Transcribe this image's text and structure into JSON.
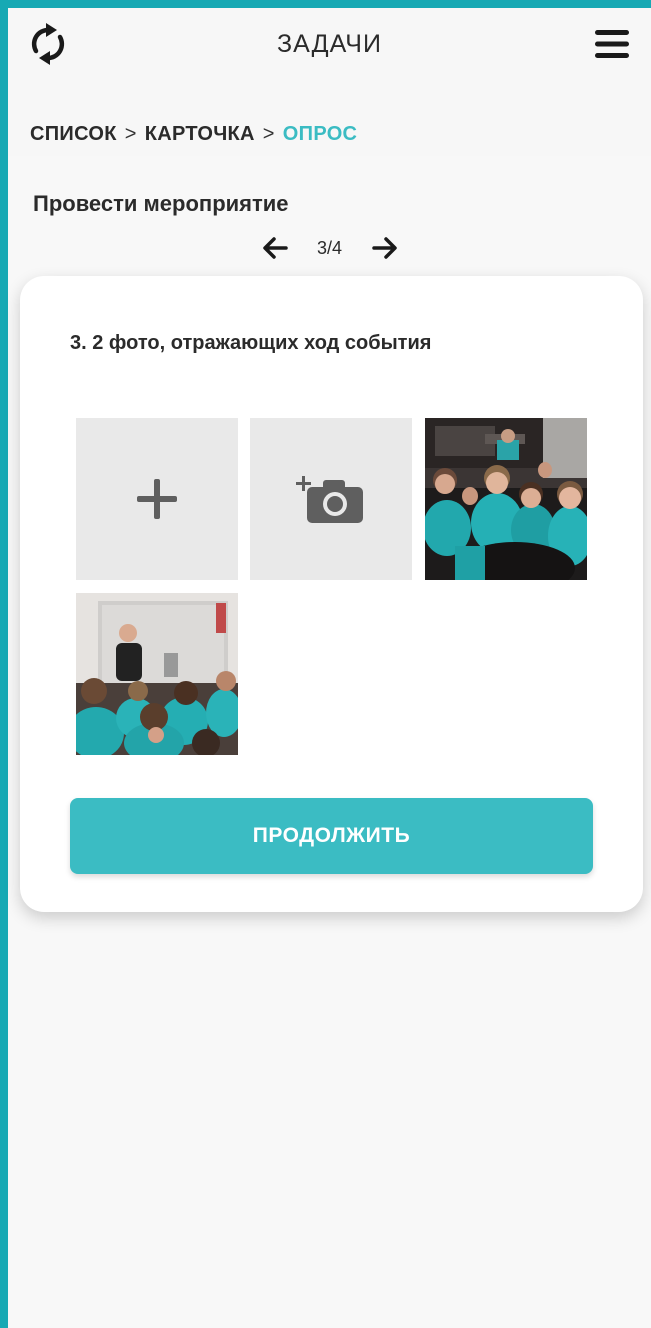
{
  "header": {
    "title": "ЗАДАЧИ",
    "refresh_icon": "refresh-icon",
    "menu_icon": "hamburger-menu-icon"
  },
  "breadcrumb": {
    "items": [
      "СПИСОК",
      "КАРТОЧКА",
      "ОПРОС"
    ],
    "separator": ">"
  },
  "task": {
    "title": "Провести мероприятие"
  },
  "pager": {
    "current": 3,
    "total": 4,
    "label": "3/4"
  },
  "survey": {
    "question": "3. 2 фото, отражающих ход события",
    "tiles": [
      {
        "kind": "add-button",
        "icon": "plus-icon"
      },
      {
        "kind": "camera-button",
        "icon": "add-camera-icon"
      },
      {
        "kind": "photo",
        "subject": "audience in teal uniforms"
      },
      {
        "kind": "photo",
        "subject": "speaker at screen with audience"
      }
    ],
    "continue_label": "ПРОДОЛЖИТЬ"
  },
  "colors": {
    "accent": "#3bbcc3",
    "frame": "#17a9b4",
    "text": "#2b2b2b",
    "tile_bg": "#e9e9e9"
  }
}
